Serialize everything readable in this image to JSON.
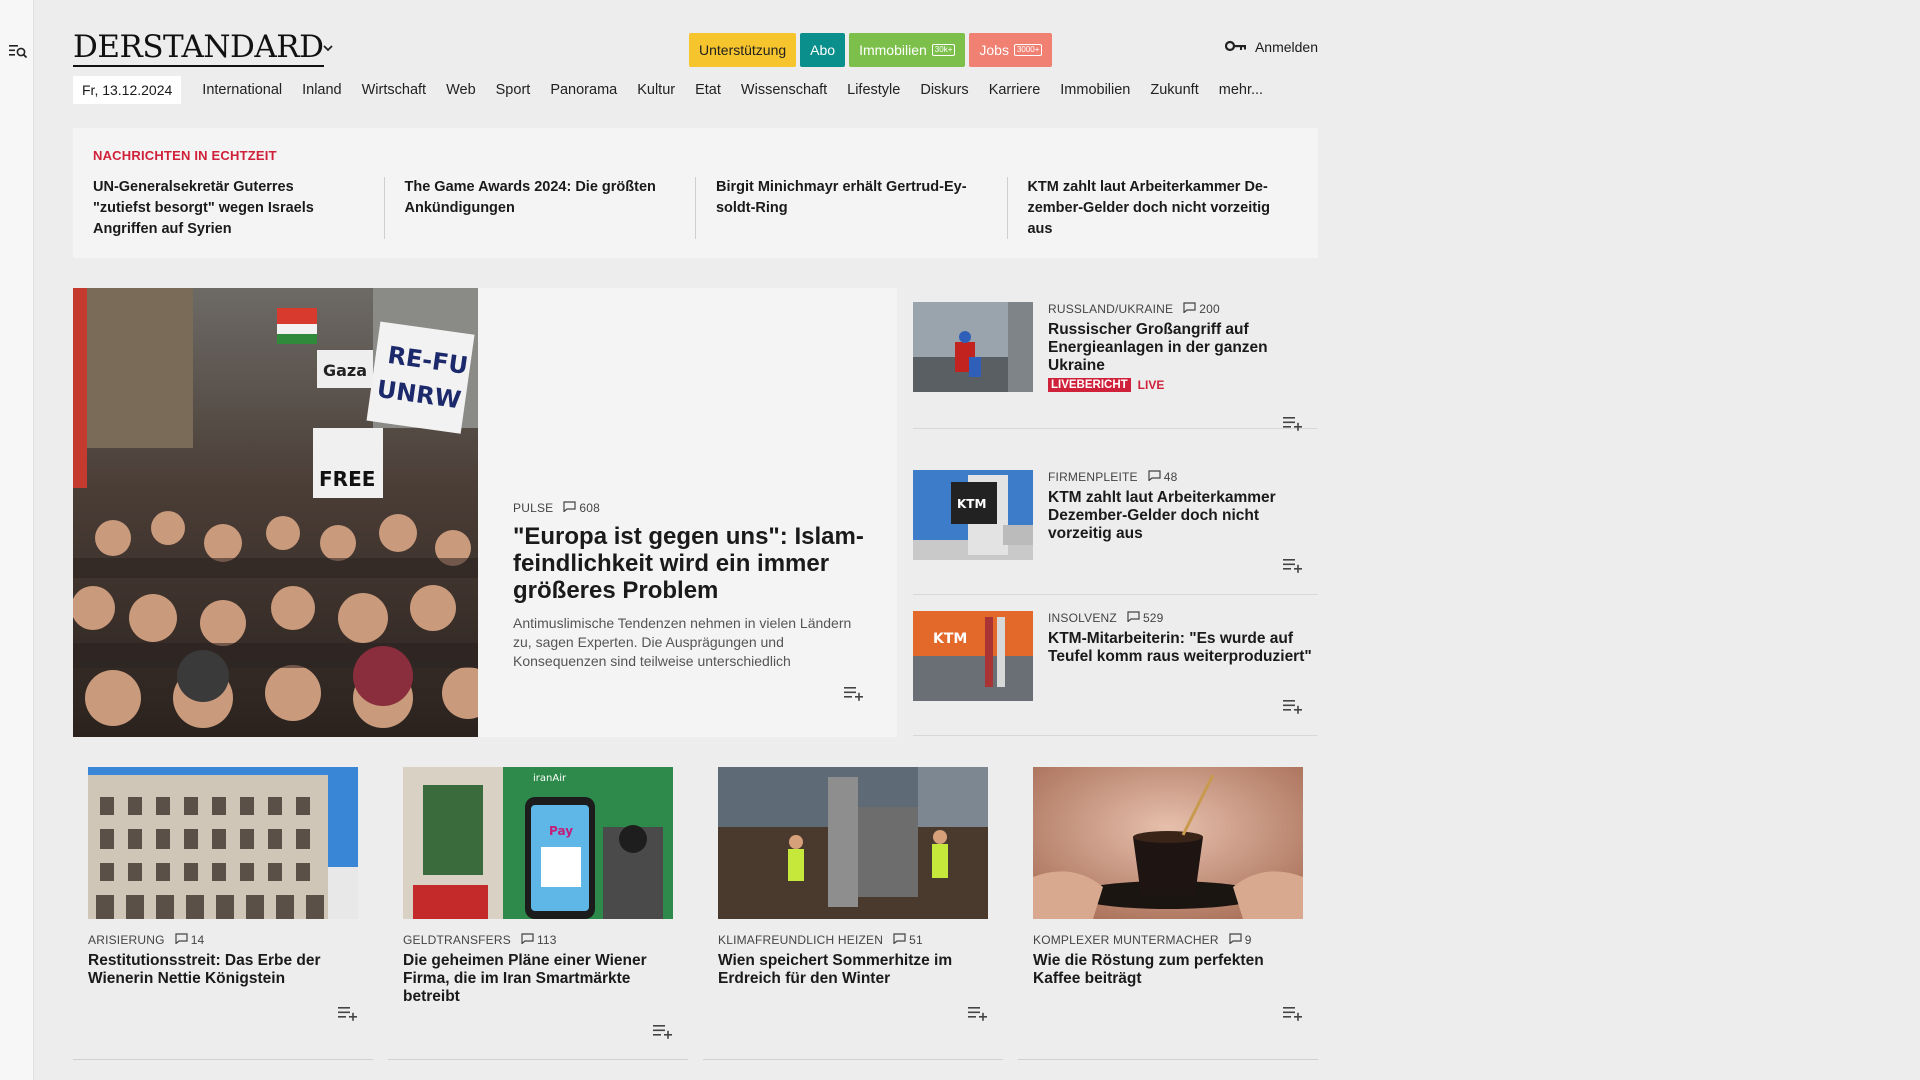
{
  "header": {
    "logo": "DERSTANDARD",
    "pills": [
      {
        "label": "Unterstützung"
      },
      {
        "label": "Abo"
      },
      {
        "label": "Immobilien",
        "badge": "30k+"
      },
      {
        "label": "Jobs",
        "badge": "3000+"
      }
    ],
    "login_label": "Anmelden"
  },
  "nav": {
    "date": "Fr, 13.12.2024",
    "items": [
      "International",
      "Inland",
      "Wirtschaft",
      "Web",
      "Sport",
      "Panorama",
      "Kultur",
      "Etat",
      "Wissenschaft",
      "Lifestyle",
      "Diskurs",
      "Karriere",
      "Immobilien",
      "Zukunft",
      "mehr..."
    ]
  },
  "ticker": {
    "heading": "NACHRICHTEN IN ECHTZEIT",
    "items": [
      "UN-Generalsekretär Guterres \"zutiefst besorgt\" wegen Israels Angriffen auf Syrien",
      "The Game Awards 2024: Die größten Ankündigungen",
      "Birgit Minichmayr erhält Gertrud-Ey­soldt-Ring",
      "KTM zahlt laut Arbeiterkammer De­zember-Gelder doch nicht vorzeitig aus"
    ]
  },
  "hero": {
    "kicker": "PULSE",
    "comments": "608",
    "title": "\"Europa ist gegen uns\": Islam­feindlichkeit wird ein immer größeres Problem",
    "teaser": "Antimuslimische Tendenzen nehmen in vielen Ländern zu, sagen Experten. Die Ausprägungen und Konsequenzen sind teilweise unterschiedlich",
    "sign_texts": [
      "RE-FU",
      "UNRW",
      "Gaza",
      "FREE"
    ]
  },
  "side_articles": [
    {
      "kicker": "RUSSLAND/UKRAINE",
      "comments": "200",
      "title": "Russischer Großangriff auf Energieanlagen in der ganzen Ukraine",
      "live_badge": "LIVEBERICHT",
      "live_text": "LIVE"
    },
    {
      "kicker": "FIRMENPLEITE",
      "comments": "48",
      "title": "KTM zahlt laut Arbeiterkammer Dezember-Gelder doch nicht vorzeitig aus",
      "img_logo": "KTM"
    },
    {
      "kicker": "INSOLVENZ",
      "comments": "529",
      "title": "KTM-Mitarbeiterin: \"Es wurde auf Teufel komm raus weiterpro­duziert\"",
      "img_logo": "KTM"
    }
  ],
  "grid_articles": [
    {
      "kicker": "ARISIERUNG",
      "comments": "14",
      "title": "Restitutionsstreit: Das Erbe der Wienerin Nettie Königstein"
    },
    {
      "kicker": "GELDTRANSFERS",
      "comments": "113",
      "title": "Die geheimen Pläne einer Wiener Firma, die im Iran Smartmärkte betreibt",
      "img_labels": [
        "iranAir",
        "Pay"
      ]
    },
    {
      "kicker": "KLIMAFREUNDLICH HEIZEN",
      "comments": "51",
      "title": "Wien speichert Sommerhitze im Erdreich für den Winter"
    },
    {
      "kicker": "KOMPLEXER MUNTERMACHER",
      "comments": "9",
      "title": "Wie die Röstung zum perfekten Kaffee beiträgt"
    }
  ],
  "colors": {
    "support": "#f6c42c",
    "abo": "#0b8f8c",
    "immobilien": "#7cc04b",
    "jobs": "#f08072",
    "accent_red": "#d0213a"
  },
  "icons": [
    "search-menu-icon",
    "chevron-down-icon",
    "key-icon",
    "comment-icon",
    "playlist-add-icon"
  ]
}
